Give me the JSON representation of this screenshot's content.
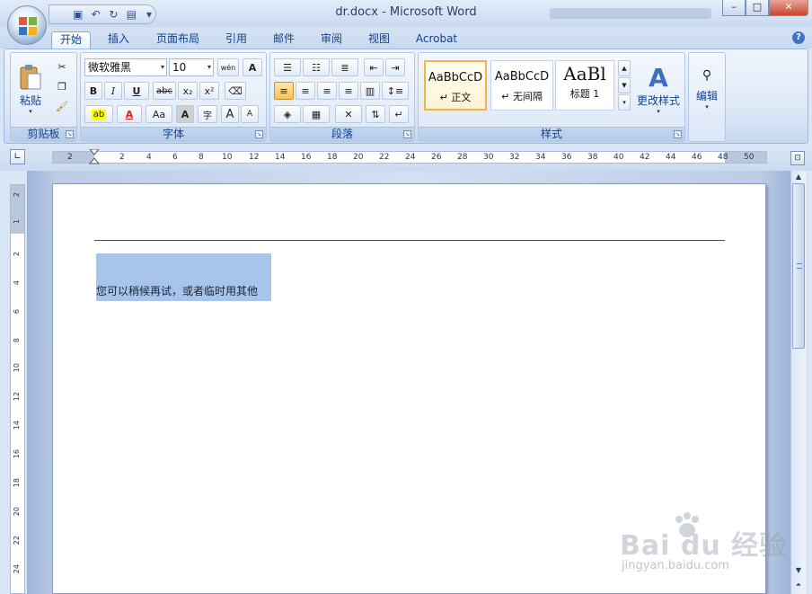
{
  "window": {
    "title": "dr.docx - Microsoft Word",
    "minimize": "–",
    "maximize": "□",
    "close": "✕"
  },
  "tabs": [
    {
      "label": "开始",
      "active": true
    },
    {
      "label": "插入"
    },
    {
      "label": "页面布局"
    },
    {
      "label": "引用"
    },
    {
      "label": "邮件"
    },
    {
      "label": "审阅"
    },
    {
      "label": "视图"
    },
    {
      "label": "Acrobat"
    }
  ],
  "ribbon": {
    "clipboard": {
      "label": "剪贴板",
      "paste": "粘贴"
    },
    "font": {
      "label": "字体",
      "font_name": "微软雅黑",
      "font_size": "10",
      "bold": "B",
      "italic": "I",
      "underline": "U",
      "strike": "abc",
      "subscript": "x₂",
      "superscript": "x²",
      "change_case": "Aa",
      "char_shade": "A",
      "grow": "A",
      "shrink": "A",
      "phonetic": "wén",
      "border_char": "A",
      "enclose": "字"
    },
    "paragraph": {
      "label": "段落"
    },
    "styles": {
      "label": "样式",
      "items": [
        {
          "preview": "AaBbCcD",
          "name": "↵ 正文",
          "selected": true
        },
        {
          "preview": "AaBbCcD",
          "name": "↵ 无间隔"
        },
        {
          "preview": "AaBl",
          "name": "标题 1"
        }
      ],
      "change_styles": "更改样式"
    },
    "editing": {
      "label": "编辑"
    }
  },
  "ruler": {
    "h_numbers": [
      "2",
      "2",
      "4",
      "6",
      "8",
      "10",
      "12",
      "14",
      "16",
      "18",
      "20",
      "22",
      "24",
      "26",
      "28",
      "30",
      "32",
      "34",
      "36",
      "38",
      "40",
      "42",
      "44",
      "46",
      "48",
      "50"
    ],
    "v_numbers": [
      "2",
      "1",
      "2",
      "4",
      "6",
      "8",
      "10",
      "12",
      "14",
      "16",
      "18",
      "20",
      "22",
      "24"
    ]
  },
  "document": {
    "text": "您可以稍候再试，或者临时用其他"
  },
  "watermark": {
    "brand": "Bai du 经验",
    "url": "jingyan.baidu.com"
  },
  "colors": {
    "accent": "#15428b",
    "selection": "#a7c4ea",
    "highlight": "#ffff00",
    "font_color": "#e0201c"
  }
}
